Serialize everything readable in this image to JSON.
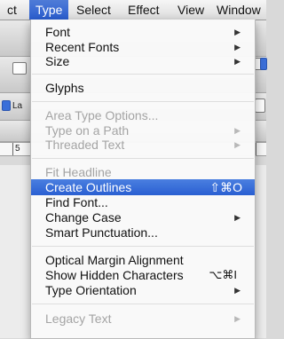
{
  "menubar": {
    "items": [
      {
        "label": "ct"
      },
      {
        "label": "Type"
      },
      {
        "label": "Select"
      },
      {
        "label": "Effect"
      },
      {
        "label": "View"
      },
      {
        "label": "Window"
      }
    ]
  },
  "background": {
    "toolbar_label_left": "La",
    "ruler_number": "5"
  },
  "type_menu": {
    "items": [
      {
        "label": "Font",
        "submenu": true
      },
      {
        "label": "Recent Fonts",
        "submenu": true
      },
      {
        "label": "Size",
        "submenu": true
      },
      {
        "label": "Glyphs"
      },
      {
        "label": "Area Type Options...",
        "disabled": true
      },
      {
        "label": "Type on a Path",
        "disabled": true,
        "submenu": true
      },
      {
        "label": "Threaded Text",
        "disabled": true,
        "submenu": true
      },
      {
        "label": "Fit Headline",
        "disabled": true
      },
      {
        "label": "Create Outlines",
        "shortcut": "⇧⌘O",
        "highlighted": true
      },
      {
        "label": "Find Font..."
      },
      {
        "label": "Change Case",
        "submenu": true
      },
      {
        "label": "Smart Punctuation..."
      },
      {
        "label": "Optical Margin Alignment"
      },
      {
        "label": "Show Hidden Characters",
        "shortcut": "⌥⌘I"
      },
      {
        "label": "Type Orientation",
        "submenu": true
      },
      {
        "label": "Legacy Text",
        "disabled": true,
        "submenu": true
      }
    ]
  },
  "colors": {
    "highlight": "#2d61d3",
    "disabled_text": "#a4a4a4"
  }
}
